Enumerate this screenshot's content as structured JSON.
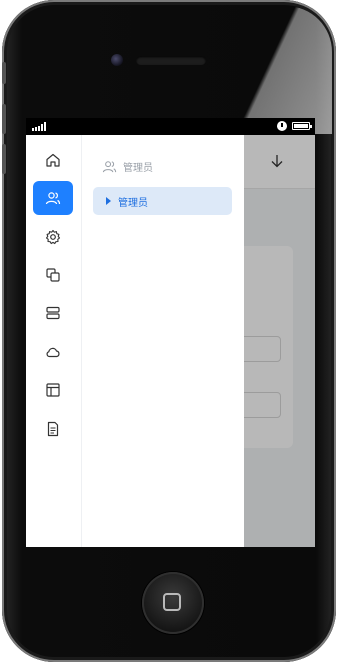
{
  "device": {
    "name": "phone",
    "battery_level": 0.9,
    "signal_bars": 5
  },
  "app": {
    "theme": {
      "accent": "#1e80ff",
      "selected_bg": "#dde9f8",
      "selected_text": "#1e6fe0",
      "muted_text": "#9aa0a8"
    },
    "rail": [
      {
        "icon": "home-icon",
        "active": false
      },
      {
        "icon": "users-icon",
        "active": true
      },
      {
        "icon": "gear-icon",
        "active": false
      },
      {
        "icon": "copy-icon",
        "active": false
      },
      {
        "icon": "server-icon",
        "active": false
      },
      {
        "icon": "cloud-icon",
        "active": false
      },
      {
        "icon": "layout-icon",
        "active": false
      },
      {
        "icon": "document-icon",
        "active": false
      }
    ],
    "panel": {
      "header_label": "管理员",
      "header_icon": "users-icon",
      "items": [
        {
          "label": "管理员",
          "icon": "caret-right-icon",
          "selected": true
        }
      ]
    },
    "header_action_icon": "arrow-down-icon"
  }
}
